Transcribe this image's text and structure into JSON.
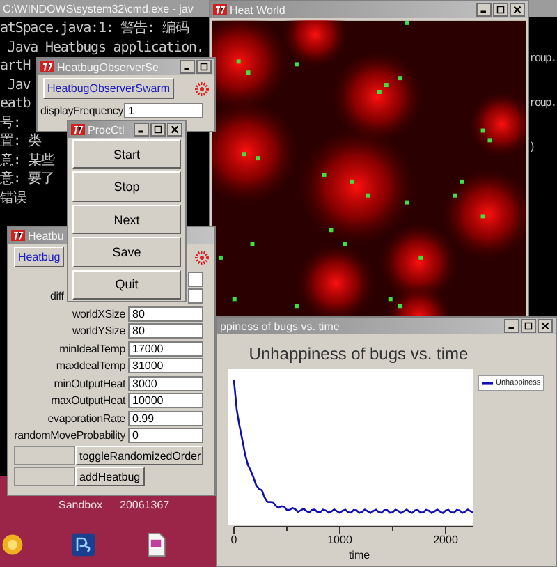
{
  "console": {
    "title": "C:\\WINDOWS\\system32\\cmd.exe - jav",
    "lines": [
      "atSpace.java:1: 警告: 编码",
      " Java Heatbugs application.",
      "artH",
      " Jav",
      "eatb",
      "号:",
      "置: 类",
      "意: 某些",
      "意: 要了",
      "错误"
    ],
    "right_lines": [
      "roup.",
      "roup.",
      ")"
    ]
  },
  "heat_window": {
    "title": "Heat World"
  },
  "chart_window": {
    "title": "ppiness of bugs vs. time",
    "chart": {
      "title": "Unhappiness of bugs vs. time",
      "legend": "Unhappiness",
      "xticks": [
        "0",
        "1000",
        "2000"
      ],
      "xlabel": "time"
    }
  },
  "model_window": {
    "title": "Heatbu",
    "swarm_button": "Heatbug",
    "fields": [
      {
        "label": "diff"
      },
      {
        "label": "worldXSize",
        "value": "80"
      },
      {
        "label": "worldYSize",
        "value": "80"
      },
      {
        "label": "minIdealTemp",
        "value": "17000"
      },
      {
        "label": "maxIdealTemp",
        "value": "31000"
      },
      {
        "label": "minOutputHeat",
        "value": "3000"
      },
      {
        "label": "maxOutputHeat",
        "value": "10000"
      },
      {
        "label": "evaporationRate",
        "value": "0.99"
      },
      {
        "label": "randomMoveProbability",
        "value": "0"
      }
    ],
    "buttons": [
      "toggleRandomizedOrder",
      "addHeatbug"
    ]
  },
  "observer_window": {
    "title": "HeatbugObserverSe",
    "swarm_button": "HeatbugObserverSwarm",
    "fields": [
      {
        "label": "displayFrequency",
        "value": "1"
      }
    ]
  },
  "proc_window": {
    "title": "ProcCtl",
    "buttons": [
      "Start",
      "Stop",
      "Next",
      "Save",
      "Quit"
    ]
  },
  "desktop": {
    "labels": [
      "Sandbox",
      "20061367"
    ],
    "icons": [
      {
        "kind": "sun"
      },
      {
        "kind": "photoshop"
      },
      {
        "kind": "document"
      }
    ]
  }
}
